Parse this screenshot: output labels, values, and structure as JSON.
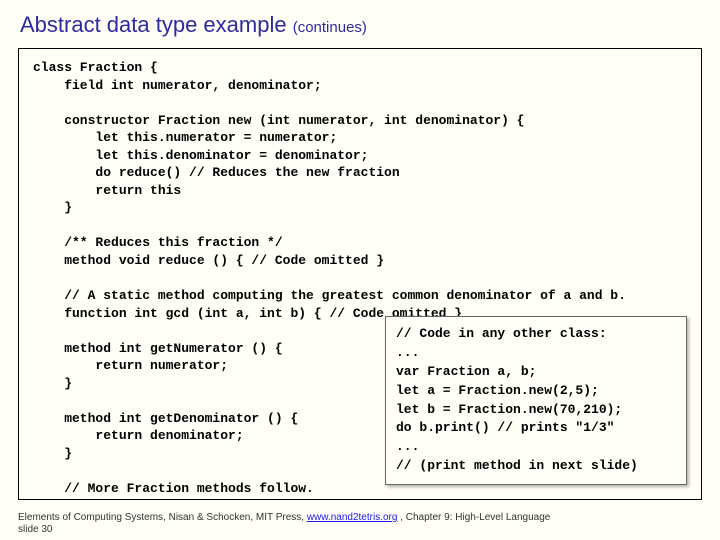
{
  "title_main": "Abstract data type example ",
  "title_cont": "(continues)",
  "code_main": "class Fraction {\n    field int numerator, denominator;\n\n    constructor Fraction new (int numerator, int denominator) {\n        let this.numerator = numerator;\n        let this.denominator = denominator;\n        do reduce() // Reduces the new fraction\n        return this\n    }\n\n    /** Reduces this fraction */\n    method void reduce () { // Code omitted }\n\n    // A static method computing the greatest common denominator of a and b.\n    function int gcd (int a, int b) { // Code omitted }\n\n    method int getNumerator () {\n        return numerator;\n    }\n\n    method int getDenominator () {\n        return denominator;\n    }\n\n    // More Fraction methods follow.",
  "code_inner": "// Code in any other class:\n...\nvar Fraction a, b;\nlet a = Fraction.new(2,5);\nlet b = Fraction.new(70,210);\ndo b.print() // prints \"1/3\"\n...\n// (print method in next slide)",
  "footer_prefix": "Elements of Computing Systems, Nisan & Schocken, MIT Press, ",
  "footer_link": "www.nand2tetris.org",
  "footer_suffix": " , Chapter 9: High-Level Language",
  "footer_line2": "slide 30"
}
